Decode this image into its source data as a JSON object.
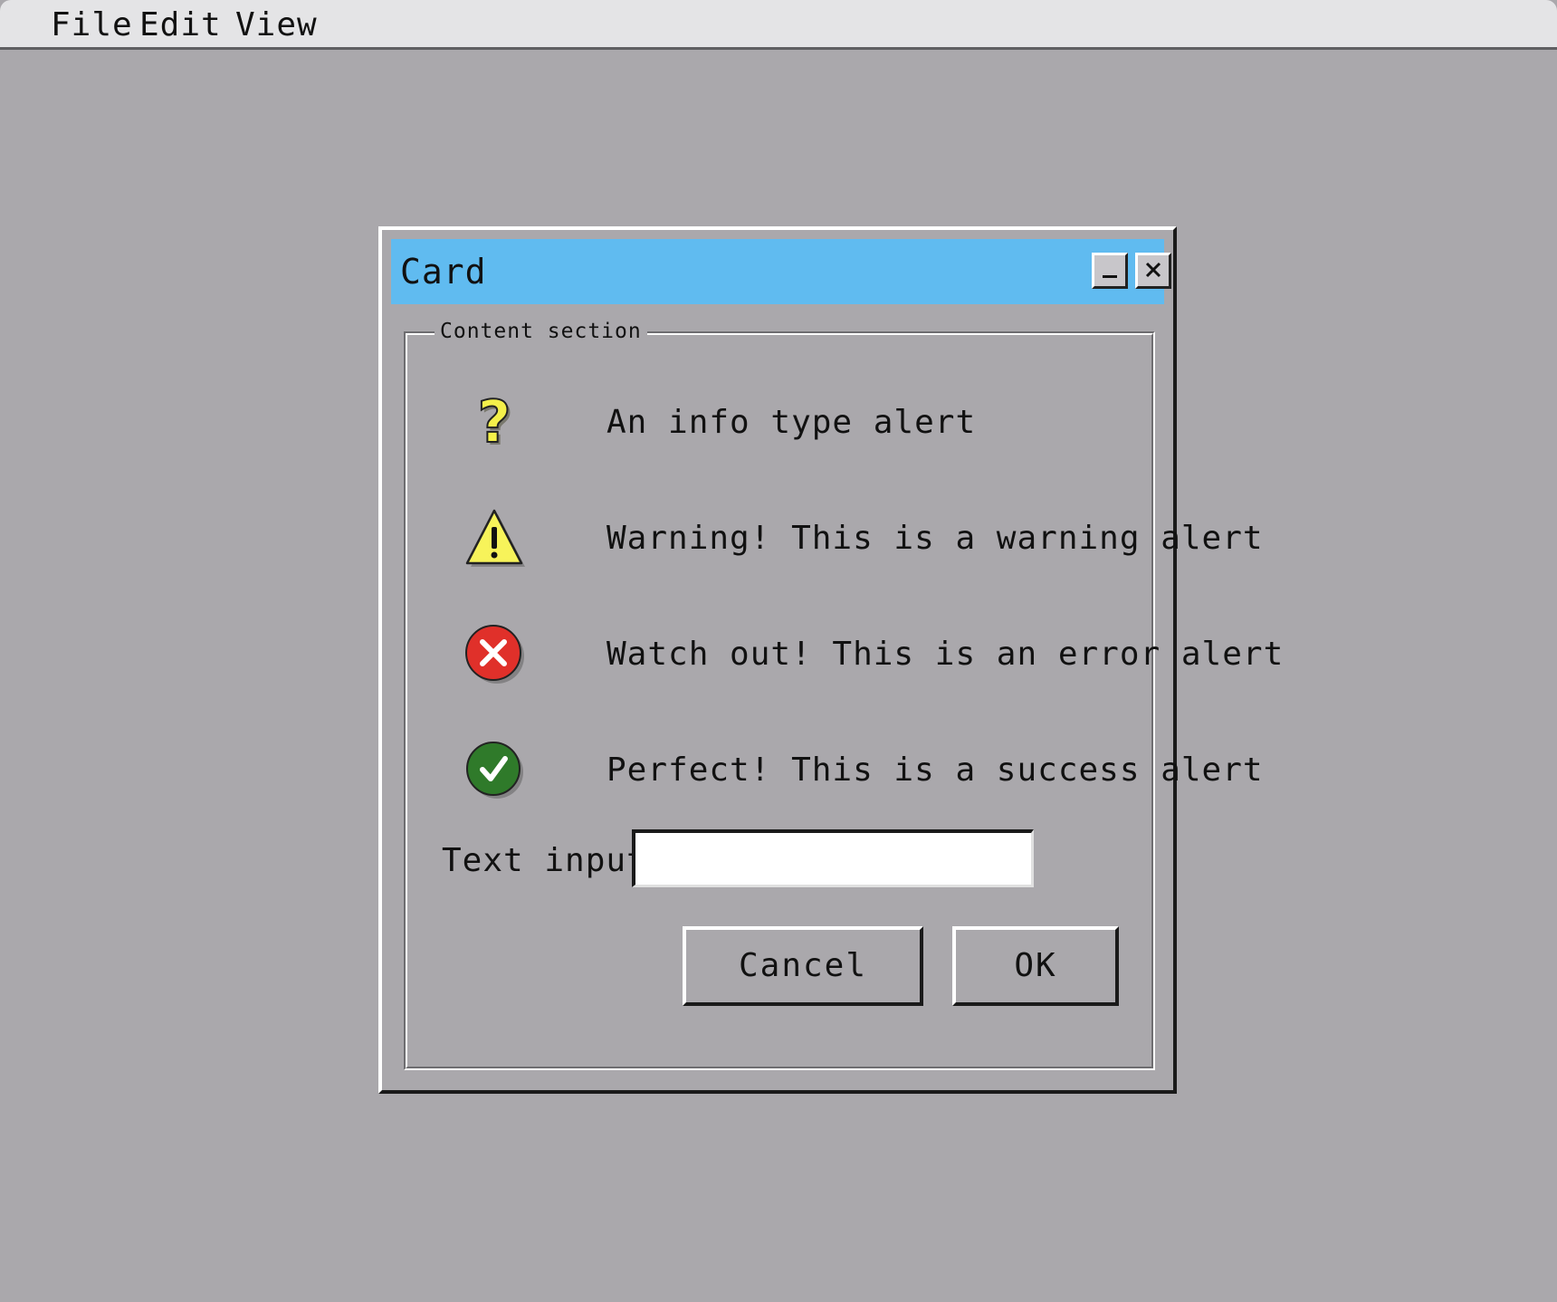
{
  "menubar": {
    "items": [
      {
        "label": "File"
      },
      {
        "label": "Edit"
      },
      {
        "label": "View"
      }
    ]
  },
  "window": {
    "title": "Card",
    "titlebar_color": "#60bbf0",
    "controls": {
      "minimize_icon": "minimize-icon",
      "close_icon": "close-icon"
    },
    "section": {
      "legend": "Content section",
      "alerts": [
        {
          "type": "info",
          "icon": "question-icon",
          "message": "An info type alert",
          "color": "#f4f04a"
        },
        {
          "type": "warning",
          "icon": "warning-icon",
          "message": "Warning! This is a warning alert",
          "color": "#f7f35a"
        },
        {
          "type": "error",
          "icon": "error-icon",
          "message": "Watch out! This is an error alert",
          "color": "#e0302a"
        },
        {
          "type": "success",
          "icon": "check-icon",
          "message": "Perfect! This is a success alert",
          "color": "#2f7a2a"
        }
      ],
      "text_input": {
        "label": "Text input",
        "value": "",
        "placeholder": ""
      },
      "buttons": {
        "cancel_label": "Cancel",
        "ok_label": "OK"
      }
    }
  }
}
